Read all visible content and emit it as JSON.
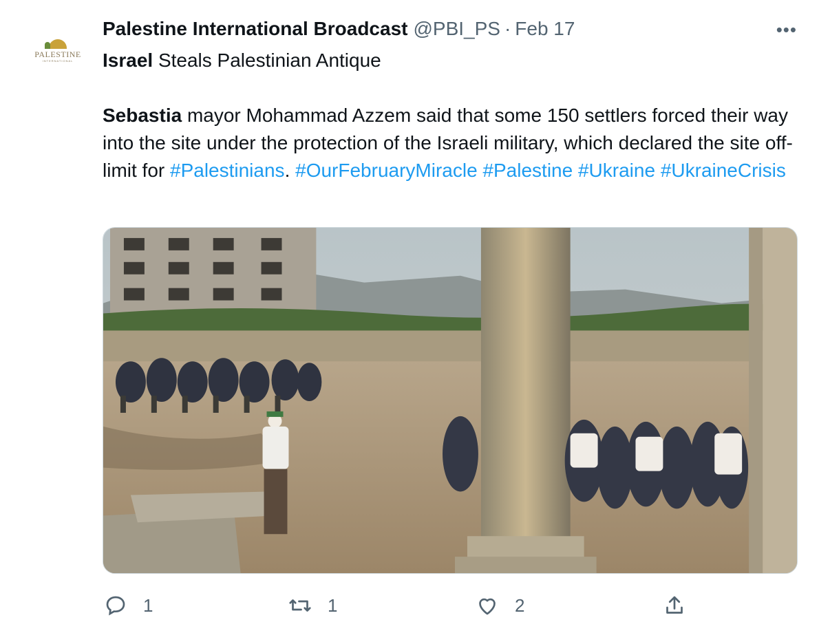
{
  "tweet": {
    "author": {
      "name": "Palestine International Broadcast",
      "handle": "@PBI_PS",
      "logo_text": "PALESTINE",
      "logo_sub": "INTERNATIONAL"
    },
    "separator": "·",
    "date": "Feb 17",
    "more": "•••",
    "line1": {
      "bold": "Israel",
      "text": " Steals Palestinian Antique"
    },
    "para": {
      "bold": "Sebastia",
      "text": " mayor Mohammad Azzem said that some 150 settlers forced their way into the site under the protection of the Israeli military, which declared the site off-limit for ",
      "hashtags": [
        "#Palestinians",
        "#OurFebruaryMiracle",
        "#Palestine",
        "#Ukraine",
        "#UkraineCrisis"
      ],
      "after_first": ". "
    },
    "media": {
      "icon": "photo-image"
    }
  },
  "actions": {
    "reply": {
      "icon": "reply-icon",
      "count": "1"
    },
    "retweet": {
      "icon": "retweet-icon",
      "count": "1"
    },
    "like": {
      "icon": "heart-icon",
      "count": "2"
    },
    "share": {
      "icon": "share-icon"
    }
  },
  "colors": {
    "link": "#1d9bf0",
    "secondary": "#536471",
    "text": "#0f1419"
  }
}
